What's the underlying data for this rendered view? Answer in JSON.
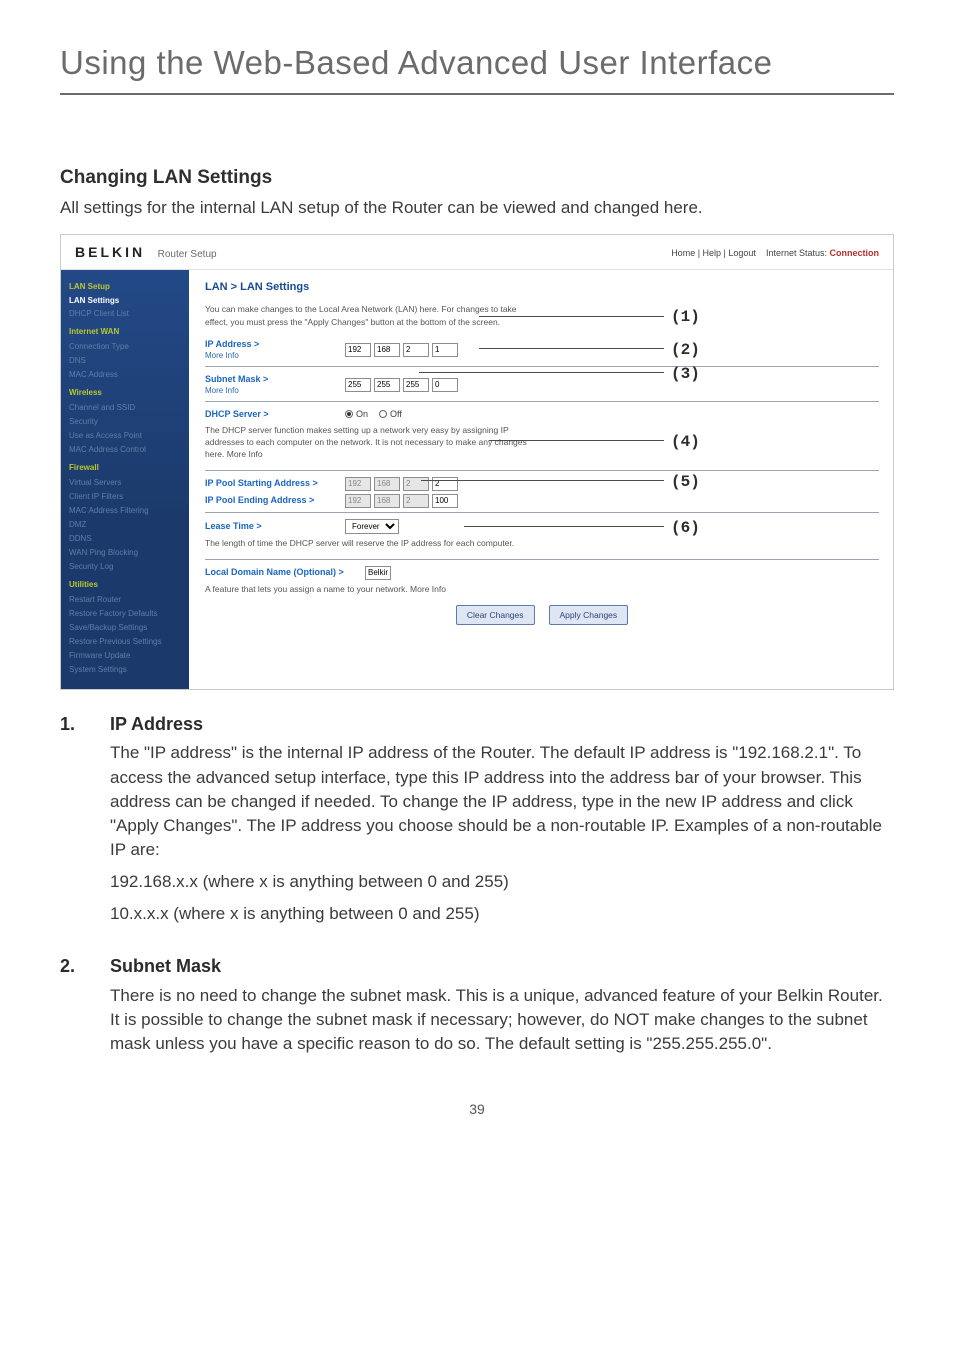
{
  "page": {
    "section_title": "Using the Web-Based Advanced User Interface",
    "heading": "Changing LAN Settings",
    "intro": "All settings for the internal LAN setup of the Router can be viewed and changed here.",
    "page_number": "39"
  },
  "shot": {
    "brand": "BELKIN",
    "brand_sub": "Router Setup",
    "top_links_left": "Home | Help | Logout",
    "top_links_status_label": "Internet Status:",
    "top_links_status_value": "Connection",
    "title": "LAN > LAN Settings",
    "desc": "You can make changes to the Local Area Network (LAN) here. For changes to take effect, you must press the \"Apply Changes\" button at the bottom of the screen.",
    "nav": [
      {
        "t": "LAN Setup",
        "c": "g"
      },
      {
        "t": "LAN Settings",
        "c": "ih"
      },
      {
        "t": "DHCP Client List",
        "c": "i"
      },
      {
        "t": "Internet WAN",
        "c": "g"
      },
      {
        "t": "Connection Type",
        "c": "i"
      },
      {
        "t": "DNS",
        "c": "i"
      },
      {
        "t": "MAC Address",
        "c": "i"
      },
      {
        "t": "Wireless",
        "c": "g"
      },
      {
        "t": "Channel and SSID",
        "c": "i"
      },
      {
        "t": "Security",
        "c": "i"
      },
      {
        "t": "Use as Access Point",
        "c": "i"
      },
      {
        "t": "MAC Address Control",
        "c": "i"
      },
      {
        "t": "Firewall",
        "c": "g"
      },
      {
        "t": "Virtual Servers",
        "c": "i"
      },
      {
        "t": "Client IP Filters",
        "c": "i"
      },
      {
        "t": "MAC Address Filtering",
        "c": "i"
      },
      {
        "t": "DMZ",
        "c": "i"
      },
      {
        "t": "DDNS",
        "c": "i"
      },
      {
        "t": "WAN Ping Blocking",
        "c": "i"
      },
      {
        "t": "Security Log",
        "c": "i"
      },
      {
        "t": "Utilities",
        "c": "g"
      },
      {
        "t": "Restart Router",
        "c": "i"
      },
      {
        "t": "Restore Factory Defaults",
        "c": "i"
      },
      {
        "t": "Save/Backup Settings",
        "c": "i"
      },
      {
        "t": "Restore Previous Settings",
        "c": "i"
      },
      {
        "t": "Firmware Update",
        "c": "i"
      },
      {
        "t": "System Settings",
        "c": "i"
      }
    ],
    "rows": {
      "ip_label": "IP Address >",
      "more_info": "More Info",
      "ip": [
        "192",
        "168",
        "2",
        "1"
      ],
      "mask_label": "Subnet Mask >",
      "mask": [
        "255",
        "255",
        "255",
        "0"
      ],
      "dhcp_label": "DHCP Server  >",
      "dhcp_on": "On",
      "dhcp_off": "Off",
      "dhcp_desc": "The DHCP server function makes setting up a network very easy by assigning IP addresses to each computer on the network. It is not necessary to make any changes here. More Info",
      "pool_start_label": "IP Pool Starting Address >",
      "pool_start": [
        "192",
        "168",
        "2",
        "2"
      ],
      "pool_end_label": "IP Pool Ending Address >",
      "pool_end": [
        "192",
        "168",
        "2",
        "100"
      ],
      "lease_label": "Lease Time >",
      "lease_value": "Forever",
      "lease_desc": "The length of time the DHCP server will reserve the IP address for each computer.",
      "domain_label": "Local Domain Name  (Optional) >",
      "domain_value": "Belkin",
      "domain_desc": "A feature that lets you assign a name to your network. More Info"
    },
    "buttons": {
      "clear": "Clear Changes",
      "apply": "Apply Changes"
    },
    "markers": {
      "1": "(1)",
      "2": "(2)",
      "3": "(3)",
      "4": "(4)",
      "5": "(5)",
      "6": "(6)"
    }
  },
  "expl": [
    {
      "num": "1.",
      "title": "IP Address",
      "paras": [
        "The \"IP address\" is the internal IP address of the Router. The default IP address is \"192.168.2.1\". To access the advanced setup interface, type this IP address into the address bar of your browser. This address can be changed if needed. To change the IP address, type in the new IP address and click \"Apply Changes\". The IP address you choose should be a non-routable IP. Examples of a non-routable IP are:",
        "192.168.x.x (where x is anything between 0 and 255)",
        "10.x.x.x (where x is anything between 0 and 255)"
      ]
    },
    {
      "num": "2.",
      "title": "Subnet Mask",
      "paras": [
        "There is no need to change the subnet mask. This is a unique, advanced feature of your Belkin Router. It is possible to change the subnet mask if necessary; however, do NOT make changes to the subnet mask unless you have a specific reason to do so. The default setting is \"255.255.255.0\"."
      ]
    }
  ]
}
